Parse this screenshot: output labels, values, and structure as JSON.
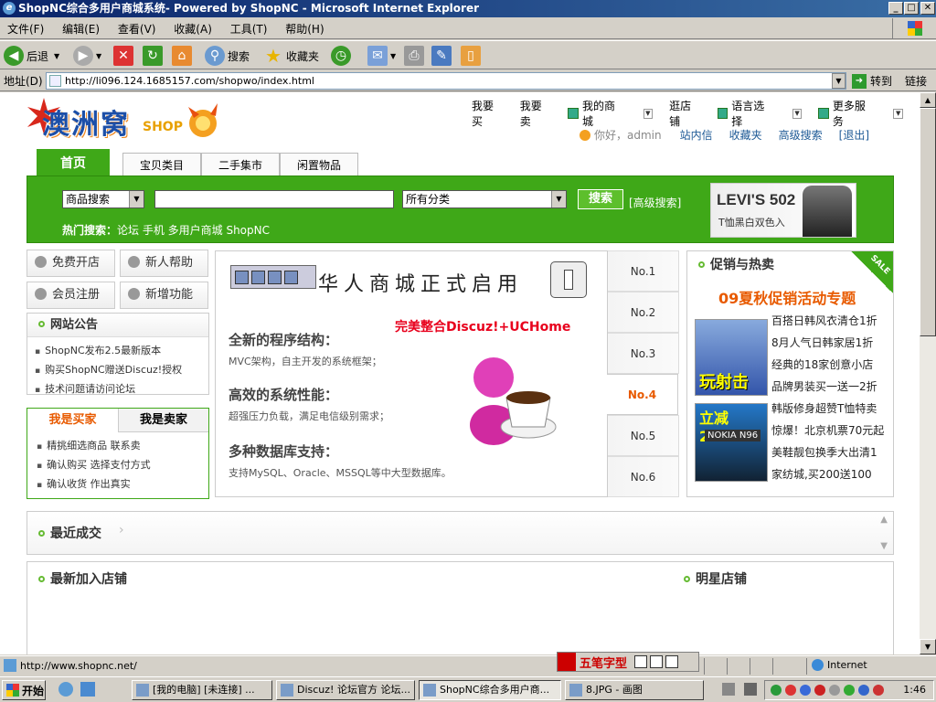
{
  "window": {
    "title": "ShopNC综合多用户商城系统- Powered by ShopNC - Microsoft Internet Explorer",
    "min": "_",
    "max": "□",
    "close": "✕"
  },
  "menu": [
    "文件(F)",
    "编辑(E)",
    "查看(V)",
    "收藏(A)",
    "工具(T)",
    "帮助(H)"
  ],
  "toolbar": {
    "back": "后退",
    "search": "搜索",
    "favorites": "收藏夹"
  },
  "address": {
    "label": "地址(D)",
    "url": "http://li096.124.1685157.com/shopwo/index.html",
    "go": "转到",
    "links": "链接"
  },
  "site": {
    "logo": "澳洲窝",
    "logo_shop": "SHOP",
    "toplinks": [
      "我要买",
      "我要卖",
      "我的商城",
      "逛店铺",
      "语言选择",
      "更多服务"
    ],
    "greeting": "你好，admin",
    "userlinks": [
      "站内信",
      "收藏夹",
      "高级搜索",
      "[退出]"
    ],
    "tabs": [
      "首页",
      "宝贝类目",
      "二手集市",
      "闲置物品"
    ],
    "search": {
      "type": "商品搜索",
      "category": "所有分类",
      "button": "搜索",
      "advanced": "[高级搜索]",
      "hot_label": "热门搜索：",
      "hot": "论坛 手机 多用户商城 ShopNC"
    },
    "ad": {
      "title": "LEVI'S 502",
      "sub": "T恤黑白双色入"
    },
    "leftbtns": [
      "免费开店",
      "新人帮助",
      "会员注册",
      "新增功能"
    ],
    "notice": {
      "title": "网站公告",
      "items": [
        "ShopNC发布2.5最新版本",
        "购买ShopNC赠送Discuz!授权",
        "技术问题请访问论坛"
      ]
    },
    "buysell": {
      "tab_buyer": "我是买家",
      "tab_seller": "我是卖家",
      "items": [
        "精挑细选商品 联系卖",
        "确认购买 选择支付方式",
        "确认收货 作出真实"
      ]
    },
    "banner": {
      "title": "华人商城正式启用",
      "sub": "完美整合Discuz!+UCHome",
      "h1": "全新的程序结构：",
      "p1": "MVC架构，自主开发的系统框架；",
      "h2": "高效的系统性能：",
      "p2": "超强压力负载，满足电信级别需求；",
      "h3": "多种数据库支持：",
      "p3": "支持MySQL、Oracle、MSSQL等中大型数据库。"
    },
    "numtabs": [
      "No.1",
      "No.2",
      "No.3",
      "No.4",
      "No.5",
      "No.6"
    ],
    "active_num": 3,
    "promo": {
      "title": "促销与热卖",
      "sale": "SALE",
      "headline": "09夏秋促销活动专题",
      "img1": "玩射击",
      "img2a": "立减200!!",
      "img2b": "NOKIA N96",
      "items": [
        "百搭日韩风衣清仓1折",
        "8月人气日韩家居1折",
        "经典的18家创意小店",
        "品牌男装买一送一2折",
        "韩版修身超赞T恤特卖",
        "惊爆！北京机票70元起",
        "美鞋靓包换季大出清1",
        "家纺城,买200送100"
      ]
    },
    "recent": "最近成交",
    "newshops": "最新加入店铺",
    "starshops": "明星店铺"
  },
  "status": {
    "url": "http://www.shopnc.net/",
    "zone": "Internet",
    "ime": "五笔字型"
  },
  "taskbar": {
    "start": "开始",
    "tasks": [
      "[我的电脑] [未连接] ...",
      "Discuz! 论坛官方 论坛...",
      "ShopNC综合多用户商...",
      "8.JPG - 画图"
    ],
    "clock": "1:46"
  }
}
